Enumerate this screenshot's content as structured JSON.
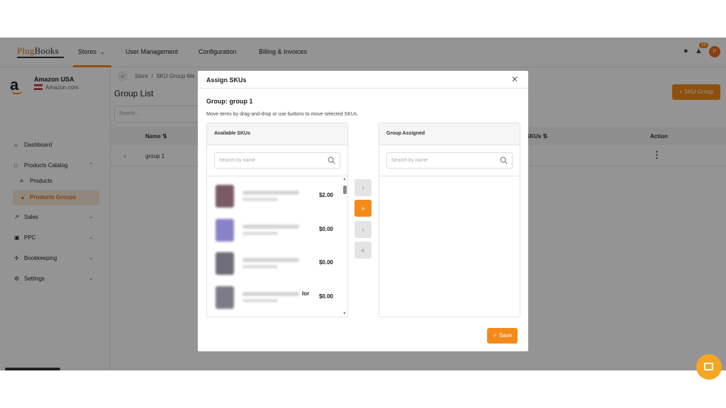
{
  "topbar": {
    "logo_part1": "Plug",
    "logo_part2": "Books",
    "nav": [
      "Stores",
      "User Management",
      "Configuration",
      "Billing & Invoices"
    ],
    "notification_count": "14",
    "avatar_initial": "P",
    "icons": [
      "lightbulb-icon",
      "bell-icon",
      "chevron-down-icon"
    ]
  },
  "sidebar": {
    "store_name": "Amazon USA",
    "store_domain": "Amazon.com",
    "items": [
      {
        "label": "Dashboard",
        "icon": "home-icon"
      },
      {
        "label": "Products Catalog",
        "icon": "catalog-icon"
      },
      {
        "label": "Products",
        "icon": "list-icon"
      },
      {
        "label": "Products Groups",
        "icon": "groups-icon"
      },
      {
        "label": "Sales",
        "icon": "chart-icon"
      },
      {
        "label": "PPC",
        "icon": "ppc-icon"
      },
      {
        "label": "Bookkeeping",
        "icon": "bookkeeping-icon"
      },
      {
        "label": "Settings",
        "icon": "gear-icon"
      }
    ]
  },
  "main": {
    "breadcrumb": [
      "Store",
      "SKU Group Ma"
    ],
    "page_title": "Group List",
    "search_placeholder": "Search...",
    "add_button_label": "SKU Group",
    "columns": [
      "Name",
      "SKUs",
      "Action"
    ],
    "rows": [
      {
        "name": "group 1"
      }
    ]
  },
  "modal": {
    "title": "Assign SKUs",
    "group_label": "Group: group 1",
    "hint": "Move items by drag-and-drop or use buttons to move selected SKUs.",
    "available_title": "Available SKUs",
    "assigned_title": "Group Assigned",
    "search_placeholder": "Search by name",
    "available_items": [
      {
        "price": "$2.00",
        "thumb_color": "#7a5a66"
      },
      {
        "price": "$0.00",
        "thumb_color": "#8a82c8"
      },
      {
        "price": "$0.00",
        "thumb_color": "#6e6e78"
      },
      {
        "price": "$0.00",
        "thumb_color": "#7c7c86"
      }
    ],
    "partial_text": "lor",
    "move_buttons": [
      {
        "glyph": "›",
        "active": false
      },
      {
        "glyph": "»",
        "active": true
      },
      {
        "glyph": "‹",
        "active": false
      },
      {
        "glyph": "«",
        "active": false
      }
    ],
    "save_label": "Save"
  },
  "colors": {
    "accent": "#f48a1a",
    "active_bg": "#fbe9d7"
  }
}
